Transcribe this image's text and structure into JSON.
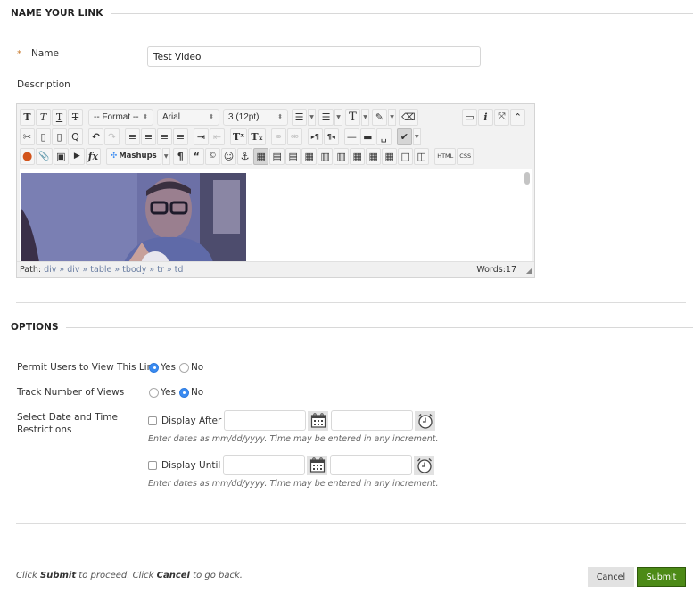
{
  "sections": {
    "name_your_link": "NAME YOUR LINK",
    "options": "OPTIONS"
  },
  "form": {
    "required_marker": "*",
    "name_label": "Name",
    "name_value": "Test Video",
    "description_label": "Description"
  },
  "editor": {
    "toolbar_row1": {
      "format_buttons": [
        {
          "icon": "bold-icon",
          "glyph": "T"
        },
        {
          "icon": "italic-icon",
          "glyph": "T"
        },
        {
          "icon": "underline-icon",
          "glyph": "T"
        },
        {
          "icon": "strikethrough-icon",
          "glyph": "T"
        }
      ],
      "format_select": "-- Format --",
      "font_select": "Arial",
      "size_select": "3 (12pt)",
      "list_buttons": [
        {
          "icon": "bullet-list-icon",
          "glyph": "☰"
        },
        {
          "icon": "numbered-list-icon",
          "glyph": "☰"
        },
        {
          "icon": "text-color-icon",
          "glyph": "T"
        },
        {
          "icon": "highlight-icon",
          "glyph": "✎"
        },
        {
          "icon": "eraser-icon",
          "glyph": "⌫"
        }
      ],
      "right_buttons": [
        {
          "icon": "preview-icon",
          "glyph": "▭"
        },
        {
          "icon": "info-icon",
          "glyph": "i"
        },
        {
          "icon": "fullscreen-icon",
          "glyph": "⤧"
        },
        {
          "icon": "collapse-icon",
          "glyph": "⌃"
        }
      ]
    },
    "toolbar_row2": [
      {
        "icon": "cut-icon",
        "glyph": "✂"
      },
      {
        "icon": "copy-icon",
        "glyph": "▯"
      },
      {
        "icon": "paste-icon",
        "glyph": "▯"
      },
      {
        "icon": "find-icon",
        "glyph": "Q"
      },
      {
        "icon": "undo-icon",
        "glyph": "↶"
      },
      {
        "icon": "redo-icon",
        "glyph": "↷",
        "disabled": true
      },
      {
        "icon": "align-left-icon",
        "glyph": "≡"
      },
      {
        "icon": "align-center-icon",
        "glyph": "≡"
      },
      {
        "icon": "align-right-icon",
        "glyph": "≡"
      },
      {
        "icon": "align-justify-icon",
        "glyph": "≡"
      },
      {
        "icon": "indent-icon",
        "glyph": "⇥"
      },
      {
        "icon": "outdent-icon",
        "glyph": "⇤",
        "disabled": true
      },
      {
        "icon": "superscript-icon",
        "glyph": "Tˣ"
      },
      {
        "icon": "subscript-icon",
        "glyph": "Tₓ"
      },
      {
        "icon": "link-icon",
        "glyph": "⚭",
        "disabled": true
      },
      {
        "icon": "unlink-icon",
        "glyph": "⚮",
        "disabled": true
      },
      {
        "icon": "ltr-icon",
        "glyph": "▸¶"
      },
      {
        "icon": "rtl-icon",
        "glyph": "¶◂"
      },
      {
        "icon": "horizontal-rule-icon",
        "glyph": "—"
      },
      {
        "icon": "thick-rule-icon",
        "glyph": "▬"
      },
      {
        "icon": "nonbreaking-space-icon",
        "glyph": "␣"
      },
      {
        "icon": "spellcheck-icon",
        "glyph": "✔"
      }
    ],
    "toolbar_row3": {
      "left": [
        {
          "icon": "record-icon",
          "glyph": "●"
        },
        {
          "icon": "attach-icon",
          "glyph": "📎"
        },
        {
          "icon": "image-icon",
          "glyph": "▣"
        },
        {
          "icon": "media-icon",
          "glyph": "▶"
        },
        {
          "icon": "formula-icon",
          "glyph": "fx"
        }
      ],
      "mashups_label": "Mashups",
      "right": [
        {
          "icon": "paragraph-icon",
          "glyph": "¶"
        },
        {
          "icon": "quote-icon",
          "glyph": "“"
        },
        {
          "icon": "copyright-icon",
          "glyph": "©"
        },
        {
          "icon": "emoticon-icon",
          "glyph": "☺"
        },
        {
          "icon": "anchor-icon",
          "glyph": "⚓"
        },
        {
          "icon": "table-icon",
          "glyph": "▦",
          "active": true
        },
        {
          "icon": "table-row-before-icon",
          "glyph": "▤"
        },
        {
          "icon": "table-row-after-icon",
          "glyph": "▤"
        },
        {
          "icon": "table-delete-row-icon",
          "glyph": "▦"
        },
        {
          "icon": "table-col-before-icon",
          "glyph": "▥"
        },
        {
          "icon": "table-col-after-icon",
          "glyph": "▥"
        },
        {
          "icon": "table-delete-col-icon",
          "glyph": "▦"
        },
        {
          "icon": "table-split-icon",
          "glyph": "▦"
        },
        {
          "icon": "table-merge-icon",
          "glyph": "▦"
        },
        {
          "icon": "table-cell-icon",
          "glyph": "□"
        },
        {
          "icon": "table-columns-icon",
          "glyph": "◫"
        },
        {
          "icon": "html-icon",
          "glyph": "HTML"
        },
        {
          "icon": "css-icon",
          "glyph": "CSS"
        }
      ]
    },
    "path_label": "Path:",
    "path": [
      "div",
      "div",
      "table",
      "tbody",
      "tr",
      "td"
    ],
    "path_separator": "»",
    "words": "Words:17"
  },
  "options": {
    "permit_label": "Permit Users to View This Link",
    "permit_selected": "Yes",
    "track_label": "Track Number of Views",
    "track_selected": "No",
    "yes_label": "Yes",
    "no_label": "No",
    "date_label": "Select Date and Time Restrictions",
    "display_after_label": "Display After",
    "display_after_checked": false,
    "display_until_label": "Display Until",
    "display_until_checked": false,
    "hint": "Enter dates as mm/dd/yyyy. Time may be entered in any increment."
  },
  "footer": {
    "note_prefix": "Click ",
    "note_submit": "Submit",
    "note_mid": " to proceed. Click ",
    "note_cancel": "Cancel",
    "note_suffix": " to go back.",
    "cancel_label": "Cancel",
    "submit_label": "Submit"
  },
  "colors": {
    "submit_bg": "#4c8a16",
    "radio_selected": "#3a8bf1",
    "required_star": "#c87a2e",
    "path_link": "#6b7fa3"
  }
}
